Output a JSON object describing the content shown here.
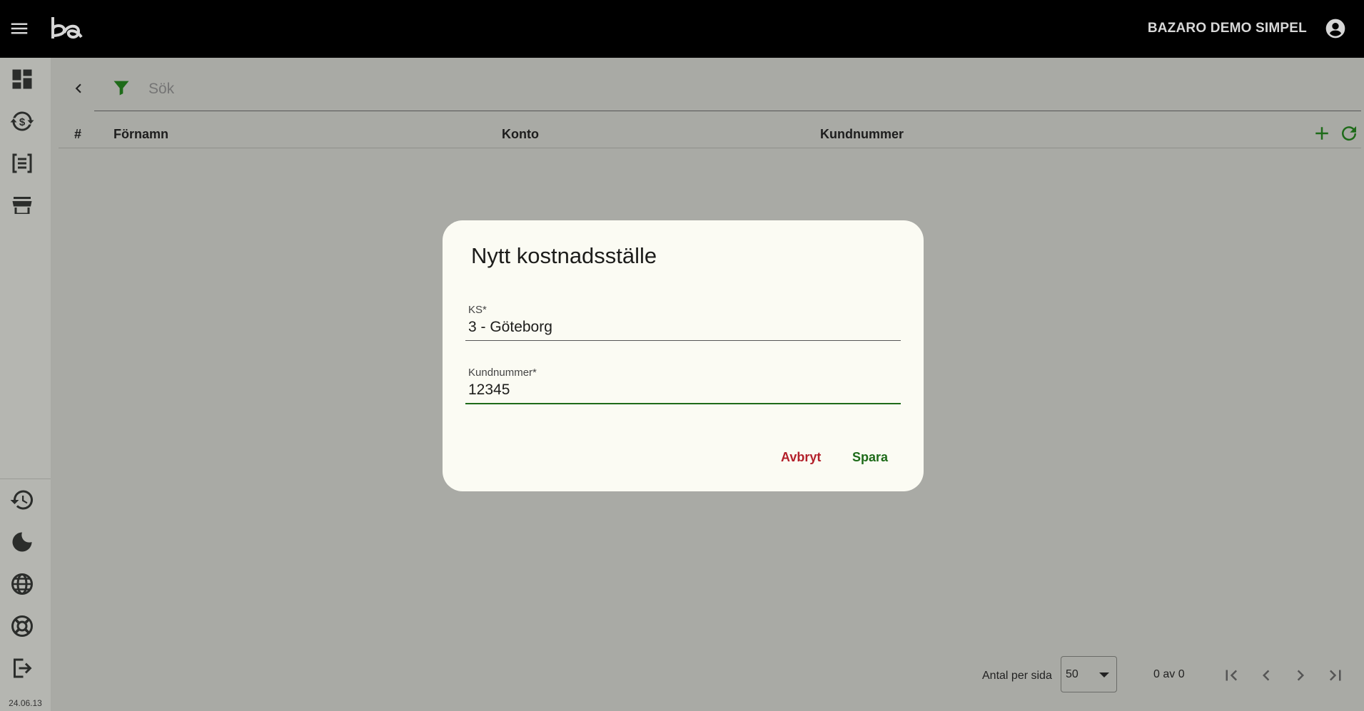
{
  "topbar": {
    "company_name": "BAZARO DEMO SIMPEL"
  },
  "sidebar": {
    "version": "24.06.13"
  },
  "search": {
    "placeholder": "Sök"
  },
  "table": {
    "columns": [
      "#",
      "Förnamn",
      "Konto",
      "Kundnummer"
    ]
  },
  "paginator": {
    "per_page_label": "Antal per sida",
    "per_page_value": "50",
    "range_label": "0 av 0"
  },
  "dialog": {
    "title": "Nytt kostnadsställe",
    "fields": [
      {
        "label": "KS*",
        "value": "3 - Göteborg"
      },
      {
        "label": "Kundnummer*",
        "value": "12345"
      }
    ],
    "cancel_label": "Avbryt",
    "save_label": "Spara"
  },
  "colors": {
    "accent_green": "#1e6b19",
    "cancel_red": "#b3202a"
  }
}
